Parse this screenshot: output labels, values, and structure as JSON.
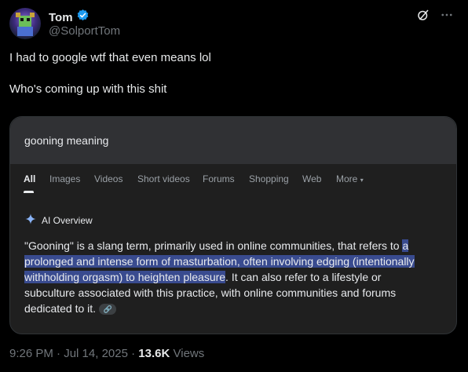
{
  "author": {
    "name": "Tom",
    "handle": "@SolportTom",
    "verified": true
  },
  "tweet": {
    "line1": "I had to google wtf that even means lol",
    "line2": "Who's coming up with this shit"
  },
  "screenshot": {
    "query": "gooning meaning",
    "tabs": [
      "All",
      "Images",
      "Videos",
      "Short videos",
      "Forums",
      "Shopping",
      "Web",
      "More"
    ],
    "active_tab": "All",
    "ai_overview_label": "AI Overview",
    "ai_text": {
      "part1": "\"Gooning\" is a slang term, primarily used in online communities, that refers to ",
      "highlight": "a prolonged and intense form of masturbation, often involving edging (intentionally withholding orgasm) to heighten pleasure",
      "part2": ". It can also refer to a lifestyle or subculture associated with this practice, with online communities and forums dedicated to it."
    }
  },
  "meta": {
    "time": "9:26 PM",
    "date": "Jul 14, 2025",
    "views_count": "13.6K",
    "views_label": "Views"
  },
  "colors": {
    "background": "#000000",
    "verified": "#1d9bf0",
    "highlight": "#394b8f"
  },
  "icons": [
    "verified-badge-icon",
    "grok-icon",
    "more-icon",
    "sparkle-icon",
    "link-icon"
  ]
}
